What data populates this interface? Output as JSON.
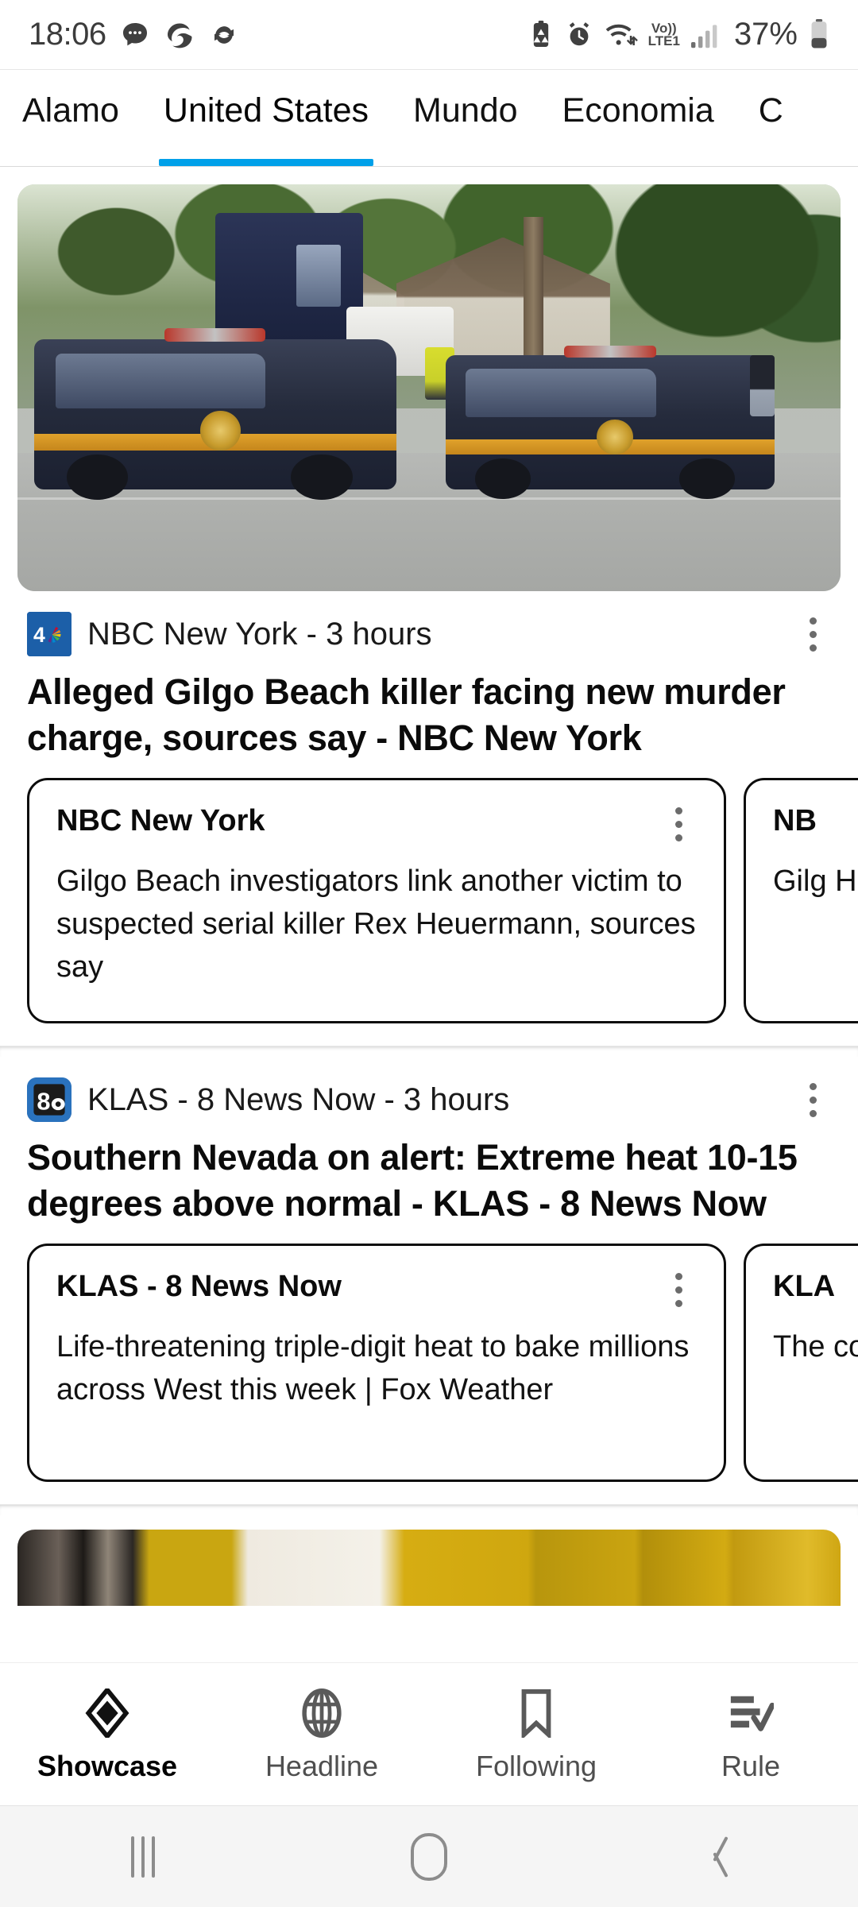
{
  "status_bar": {
    "time": "18:06",
    "left_icons": [
      "message-bubble-icon",
      "edge-browser-icon",
      "sync-refresh-icon"
    ],
    "right_icons": [
      "battery-saver-icon",
      "alarm-icon",
      "wifi-icon"
    ],
    "network_label_top": "Vo))",
    "network_label_bottom": "LTE1",
    "signal_icon": "cellular-signal-icon",
    "battery_percent": "37%",
    "battery_icon": "battery-icon"
  },
  "tabs": {
    "items": [
      {
        "label": "Alamo",
        "active": false
      },
      {
        "label": "United States",
        "active": true
      },
      {
        "label": "Mundo",
        "active": false
      },
      {
        "label": "Economia",
        "active": false
      },
      {
        "label": "C",
        "active": false
      }
    ],
    "active_underline_color": "#00a0e9"
  },
  "feed": {
    "stories": [
      {
        "hero_image_alt": "New York State Trooper SUVs parked on a residential street",
        "source_logo": "nbc-4-new-york-logo",
        "source_line": "NBC New York - 3 hours",
        "menu_icon": "kebab-menu-icon",
        "headline": "Alleged Gilgo Beach killer facing new murder charge, sources say - NBC New York",
        "cards": [
          {
            "source": "NBC New York",
            "menu_icon": "kebab-menu-icon",
            "text": "Gilgo Beach investigators link another victim to suspected serial killer Rex Heuermann, sources say"
          },
          {
            "source": "NB",
            "menu_icon": "kebab-menu-icon",
            "text": "Gilg Heu new"
          }
        ]
      },
      {
        "source_logo": "klas-8-news-now-logo",
        "source_line": "KLAS - 8 News Now - 3 hours",
        "menu_icon": "kebab-menu-icon",
        "headline": "Southern Nevada on alert: Extreme heat 10-15 degrees above normal - KLAS - 8 News Now",
        "cards": [
          {
            "source": "KLAS - 8 News Now",
            "menu_icon": "kebab-menu-icon",
            "text": "Life-threatening triple-digit heat to bake millions across West this week | Fox Weather"
          },
          {
            "source": "KLA",
            "menu_icon": "kebab-menu-icon",
            "text": "The coo"
          }
        ]
      }
    ]
  },
  "bottom_nav": {
    "items": [
      {
        "label": "Showcase",
        "icon": "diamond-icon",
        "active": true
      },
      {
        "label": "Headline",
        "icon": "globe-icon",
        "active": false
      },
      {
        "label": "Following",
        "icon": "bookmark-icon",
        "active": false
      },
      {
        "label": "Rule",
        "icon": "list-check-icon",
        "active": false
      }
    ]
  },
  "system_nav": {
    "recents_icon": "recents-icon",
    "home_icon": "home-icon",
    "back_icon": "back-icon"
  }
}
